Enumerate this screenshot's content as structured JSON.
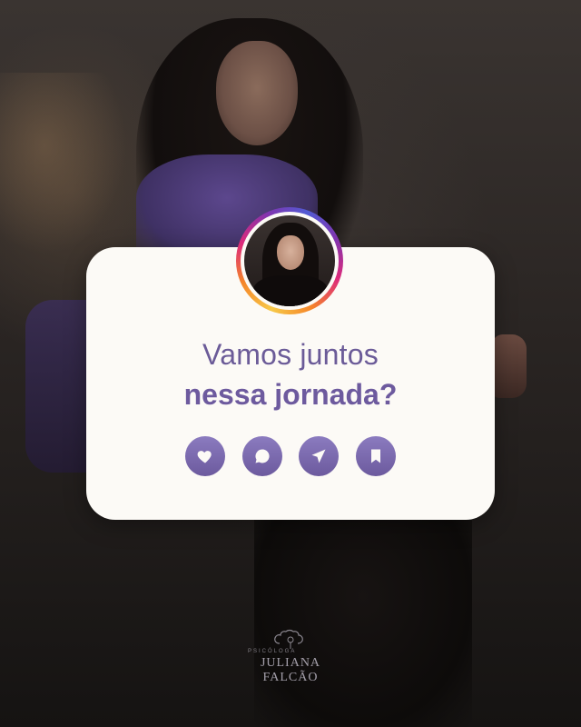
{
  "card": {
    "headline_line1": "Vamos juntos",
    "headline_line2": "nessa jornada?"
  },
  "actions": [
    {
      "name": "like",
      "icon": "heart-icon"
    },
    {
      "name": "comment",
      "icon": "chat-bubble-icon"
    },
    {
      "name": "share",
      "icon": "send-icon"
    },
    {
      "name": "save",
      "icon": "bookmark-icon"
    }
  ],
  "logo": {
    "subtitle": "PSICÓLOGA",
    "name": "JULIANA FALCÃO",
    "icon": "brain-flower-logo"
  },
  "colors": {
    "accent": "#6b5b98",
    "card_bg": "#fcfaf6",
    "story_ring": [
      "#f7c948",
      "#f58529",
      "#dd2a7b",
      "#8134af",
      "#515bd4"
    ]
  }
}
